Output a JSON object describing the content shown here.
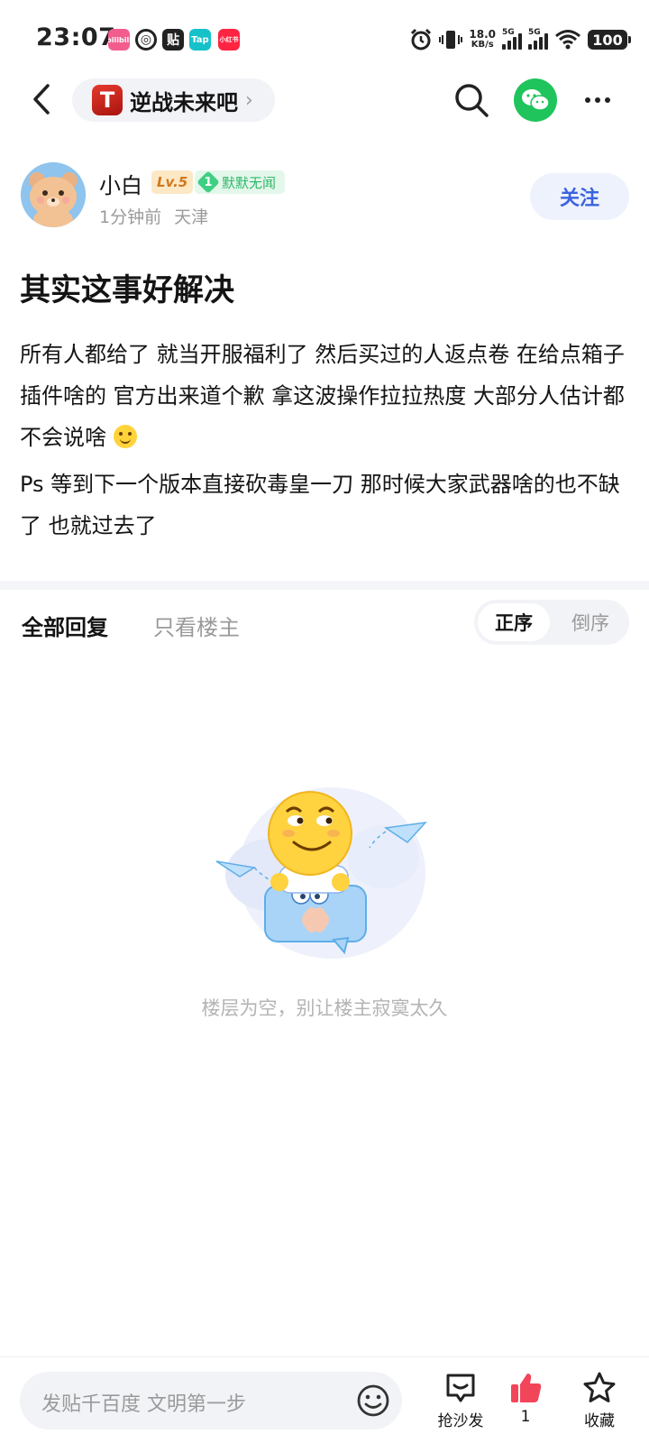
{
  "status_bar": {
    "time": "23:07",
    "net_speed_value": "18.0",
    "net_speed_unit": "KB/s",
    "sim1": "5G",
    "sim2": "5G",
    "battery": "100",
    "app_icons": [
      {
        "name": "bilibili-icon",
        "color": "#f25d8e",
        "text": "bilibili"
      },
      {
        "name": "netease-music-icon",
        "color": "#222222",
        "text": "◎"
      },
      {
        "name": "tieba-icon",
        "color": "#222222",
        "text": "贴"
      },
      {
        "name": "taptap-icon",
        "color": "#16c2c9",
        "text": "Tap"
      },
      {
        "name": "xiaohongshu-icon",
        "color": "#ff2442",
        "text": "小红书"
      }
    ]
  },
  "nav": {
    "forum_logo_text": "T",
    "forum_name": "逆战未来吧"
  },
  "author": {
    "name": "小白",
    "level": "Lv.5",
    "rank_number": "1",
    "rank_title": "默默无闻",
    "time_ago": "1分钟前",
    "location": "天津",
    "follow_label": "关注"
  },
  "post": {
    "title": "其实这事好解决",
    "paragraph1": "所有人都给了 就当开服福利了 然后买过的人返点卷 在给点箱子插件啥的 官方出来道个歉 拿这波操作拉拉热度 大部分人估计都不会说啥",
    "paragraph2": "Ps 等到下一个版本直接砍毒皇一刀 那时候大家武器啥的也不缺了 也就过去了"
  },
  "replies": {
    "tab_all": "全部回复",
    "tab_op_only": "只看楼主",
    "sort_asc": "正序",
    "sort_desc": "倒序",
    "empty_text": "楼层为空，别让楼主寂寞太久"
  },
  "bottom_bar": {
    "input_placeholder": "发贴千百度 文明第一步",
    "sofa_label": "抢沙发",
    "like_count": "1",
    "collect_label": "收藏"
  },
  "colors": {
    "accent_blue": "#3a63e0",
    "wechat_green": "#1fc45c",
    "like_red": "#f2455a",
    "level_orange": "#d0771d",
    "rank_green": "#2fb86a"
  }
}
